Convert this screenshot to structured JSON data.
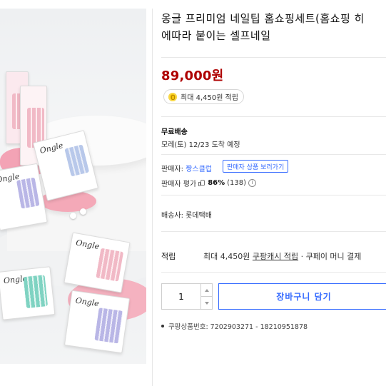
{
  "product": {
    "title_line1": "옹글 프리미엄 네일팁 홈쇼핑세트(홈쇼핑 히",
    "title_line2": "에따라 붙이는 셀프네일",
    "price": "89,000원",
    "reward_badge": "최대 4,450원 적립",
    "image_brand_text": "Ongle"
  },
  "shipping": {
    "type": "무료배송",
    "arrival": "모레(토) 12/23 도착 예정"
  },
  "seller": {
    "label": "판매자:",
    "name": "짱스클럽",
    "other_products_button": "판매자 상품 보러가기",
    "rating_label": "판매자 평가",
    "rating_percent": "86%",
    "rating_count": "(138)",
    "info_symbol": "i"
  },
  "delivery": {
    "carrier": "배송사: 롯데택배"
  },
  "points": {
    "label": "적립",
    "max_text": "최대 4,450원",
    "cash_link": "쿠팡캐시 적립",
    "separator": "·",
    "pay_text": "쿠페이 머니 결제"
  },
  "cart": {
    "quantity": "1",
    "add_to_cart": "장바구니 담기"
  },
  "product_number": "쿠팡상품번호: 7202903271 - 18210951878"
}
